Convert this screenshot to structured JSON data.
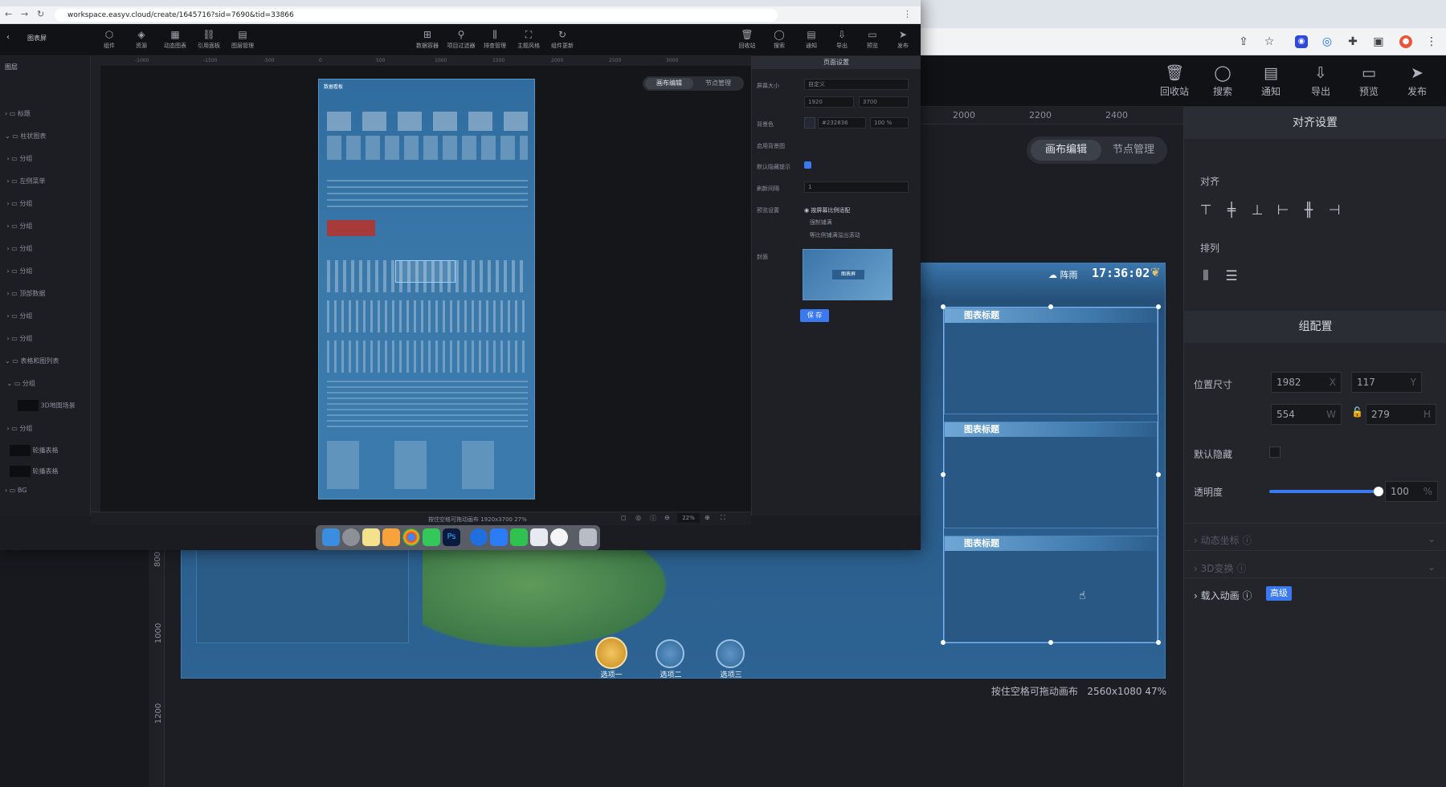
{
  "browser": {
    "url": "workspace.easyv.cloud/create/1645716?sid=7690&tid=33866"
  },
  "back_toolbar": [
    {
      "label": "回收站",
      "icon": "trash-icon"
    },
    {
      "label": "搜索",
      "icon": "search-icon"
    },
    {
      "label": "通知",
      "icon": "bell-icon"
    },
    {
      "label": "导出",
      "icon": "export-icon"
    },
    {
      "label": "预览",
      "icon": "preview-icon"
    },
    {
      "label": "发布",
      "icon": "send-icon"
    }
  ],
  "canvas": {
    "ruler_top": [
      "2000",
      "2200",
      "2400"
    ],
    "ruler_left": [
      "800",
      "1000",
      "1200"
    ],
    "tabs": {
      "edit": "画布编辑",
      "nodes": "节点管理"
    },
    "weather": "阵雨",
    "clock": "17:36:02",
    "panel_titles": [
      "图表标题",
      "图表标题",
      "图表标题"
    ],
    "nav_buttons": [
      "选项一",
      "选项二",
      "选项三"
    ],
    "status": "按住空格可拖动画布",
    "size_zoom": "2560x1080 47%"
  },
  "right_panel": {
    "title": "对齐设置",
    "align_label": "对齐",
    "distribute_label": "排列",
    "group_title": "组配置",
    "position_label": "位置尺寸",
    "x": "1982",
    "x_unit": "X",
    "y": "117",
    "y_unit": "Y",
    "w": "554",
    "w_unit": "W",
    "h": "279",
    "h_unit": "H",
    "hidden_label": "默认隐藏",
    "opacity_label": "透明度",
    "opacity": "100",
    "opacity_unit": "%",
    "opacity_level": 1.0,
    "dynamic_label": "动态坐标",
    "transform_label": "3D变换",
    "animation_label": "载入动画",
    "advanced_badge": "高级"
  },
  "front_window": {
    "back_label": "图表屏",
    "toolbar_left": [
      "组件",
      "资源",
      "动态图表",
      "引用面板",
      "图层管理"
    ],
    "toolbar_mid": [
      "数据容器",
      "项目过滤器",
      "排查管理",
      "主题风格",
      "组件更新"
    ],
    "toolbar_right": [
      "回收站",
      "搜索",
      "通知",
      "导出",
      "预览",
      "发布"
    ],
    "layers_title": "图层",
    "layers": [
      "标题",
      "柱状图表",
      "分组",
      "左侧菜单",
      "分组",
      "分组",
      "分组",
      "分组",
      "顶部数据",
      "分组",
      "分组",
      "表格和图列表",
      "分组",
      "3D地图场景",
      "分组",
      "轮播表格",
      "轮播表格",
      "BG"
    ],
    "ruler": [
      "-1000",
      "-1500",
      "-500",
      "0",
      "500",
      "1000",
      "1500",
      "2000",
      "2500",
      "3000"
    ],
    "thumb_title": "数据看板",
    "tabs": {
      "edit": "画布编辑",
      "nodes": "节点管理"
    },
    "settings": {
      "title": "页面设置",
      "screen_size_label": "屏幕大小",
      "screen_size": "自定义",
      "width": "1920",
      "height": "3700",
      "bg_label": "背景色",
      "bg_color": "#232836",
      "bg_opacity": "100",
      "bg_opacity_unit": "%",
      "bg_image_label": "启用背景图",
      "grid_label": "默认隐藏提示",
      "interval_label": "刷新间隔",
      "interval": "1",
      "preview_label": "预览设置",
      "preview_options": [
        "按屏幕比例适配",
        "强制铺满",
        "等比例铺满溢出滚动"
      ],
      "cover_label": "封面",
      "cover_caption": "图表屏",
      "save_button": "保 存"
    },
    "status": "按住空格可拖动画布  1920x3700 27%",
    "zoom": "22%"
  }
}
